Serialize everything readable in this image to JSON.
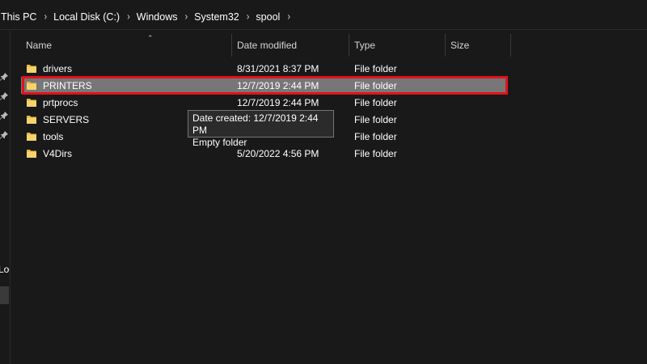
{
  "breadcrumb": [
    "This PC",
    "Local Disk (C:)",
    "Windows",
    "System32",
    "spool"
  ],
  "columns": {
    "name": "Name",
    "date_modified": "Date modified",
    "type": "Type",
    "size": "Size"
  },
  "files": [
    {
      "name": "drivers",
      "date": "8/31/2021 8:37 PM",
      "type": "File folder"
    },
    {
      "name": "PRINTERS",
      "date": "12/7/2019 2:44 PM",
      "type": "File folder",
      "selected": true
    },
    {
      "name": "prtprocs",
      "date": "12/7/2019 2:44 PM",
      "type": "File folder"
    },
    {
      "name": "SERVERS",
      "date": "",
      "type": "File folder"
    },
    {
      "name": "tools",
      "date": "",
      "type": "File folder"
    },
    {
      "name": "V4Dirs",
      "date": "5/20/2022 4:56 PM",
      "type": "File folder"
    }
  ],
  "tooltip": {
    "line1": "Date created: 12/7/2019 2:44 PM",
    "line2": "Empty folder"
  },
  "nav": {
    "local_label": "Local"
  },
  "colors": {
    "background": "#191919",
    "selection": "#777777",
    "highlight_border": "#e0131b",
    "folder": "#f2c84b"
  },
  "icons": {
    "folder": "folder-icon",
    "pin": "pin-icon",
    "chevron": "chevron-right-icon",
    "sort": "sort-up-icon"
  }
}
